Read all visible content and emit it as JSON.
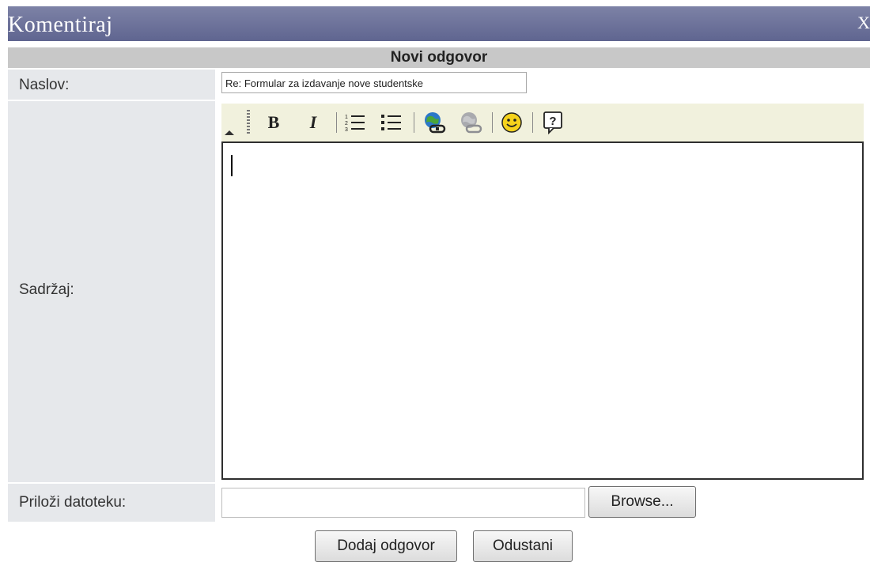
{
  "window": {
    "title": "Komentiraj",
    "close_label": "X"
  },
  "form": {
    "header": "Novi odgovor",
    "naslov_label": "Naslov:",
    "naslov_value": "Re: Formular za izdavanje nove studentske",
    "sadrzaj_label": "Sadržaj:",
    "prilozi_label": "Priloži datoteku:",
    "browse_label": "Browse...",
    "submit_label": "Dodaj odgovor",
    "cancel_label": "Odustani"
  },
  "toolbar": {
    "bold_label": "B",
    "italic_label": "I",
    "help_label": "?",
    "icons": [
      "collapse-icon",
      "bold-icon",
      "italic-icon",
      "ordered-list-icon",
      "unordered-list-icon",
      "insert-link-icon",
      "remove-link-icon",
      "smiley-icon",
      "help-icon"
    ]
  }
}
